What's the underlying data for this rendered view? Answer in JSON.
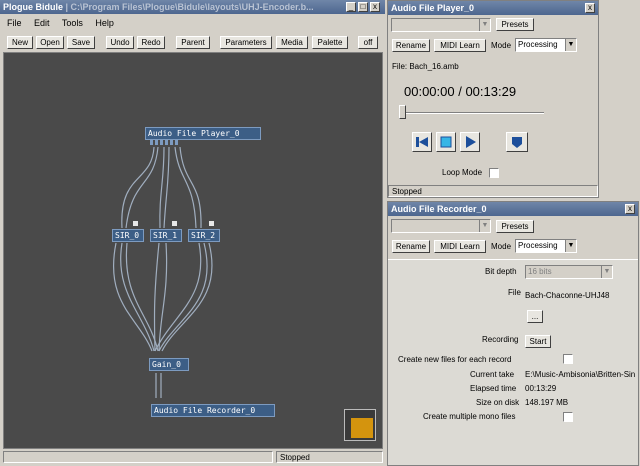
{
  "main": {
    "title_bold": "Plogue Bidule",
    "title_path": " | C:\\Program Files\\Plogue\\Bidule\\layouts\\UHJ-Encoder.b...",
    "menu": [
      "File",
      "Edit",
      "Tools",
      "Help"
    ],
    "toolbar": [
      "New",
      "Open",
      "Save",
      "Undo",
      "Redo",
      "Parent",
      "Parameters",
      "Media",
      "Palette",
      "off"
    ],
    "nodes": {
      "player": "Audio File Player_0",
      "sir0": "SIR_0",
      "sir1": "SIR_1",
      "sir2": "SIR_2",
      "gain": "Gain_0",
      "recorder": "Audio File Recorder_0"
    },
    "status": "Stopped",
    "colors": {
      "canvas": "#4a4a4a",
      "node": "#3c5e86",
      "wire": "#aab9cc",
      "thumb": "#d4940e"
    }
  },
  "player": {
    "title": "Audio File Player_0",
    "presets": "Presets",
    "rename": "Rename",
    "midi_learn": "MIDI Learn",
    "mode_label": "Mode",
    "mode_value": "Processing",
    "file": "File: Bach_16.amb",
    "time": "00:00:00 / 00:13:29",
    "progress": 0,
    "loop_label": "Loop Mode",
    "status": "Stopped",
    "icons": [
      "rewind-icon",
      "stop-icon",
      "play-icon",
      "eject-icon"
    ]
  },
  "recorder": {
    "title": "Audio File Recorder_0",
    "presets": "Presets",
    "rename": "Rename",
    "midi_learn": "MIDI Learn",
    "mode_label": "Mode",
    "mode_value": "Processing",
    "bit_depth_label": "Bit depth",
    "bit_depth_value": "16 bits",
    "file_label": "File",
    "file_value": "Bach-Chaconne-UHJ48",
    "browse": "...",
    "recording_label": "Recording",
    "start": "Start",
    "new_files_label": "Create new files for each record",
    "current_take_label": "Current take",
    "current_take_value": "E:\\Music-Ambisonia\\Britten-Sin",
    "elapsed_label": "Elapsed time",
    "elapsed_value": "00:13:29",
    "size_label": "Size on disk",
    "size_value": "148.197 MB",
    "mono_label": "Create multiple mono files"
  }
}
